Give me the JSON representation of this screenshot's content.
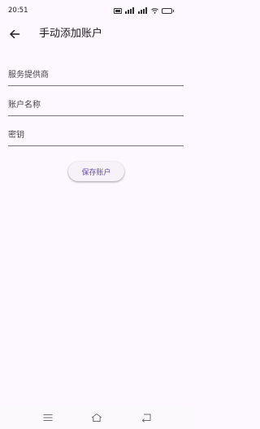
{
  "status_bar": {
    "time": "20:51",
    "battery": "100"
  },
  "header": {
    "title": "手动添加账户"
  },
  "form": {
    "provider_placeholder": "服务提供商",
    "account_name_placeholder": "账户名称",
    "secret_key_placeholder": "密钥",
    "save_label": "保存账户"
  },
  "colors": {
    "background": "#fdf7ff",
    "accent": "#6750a4",
    "underline": "#79747e"
  }
}
